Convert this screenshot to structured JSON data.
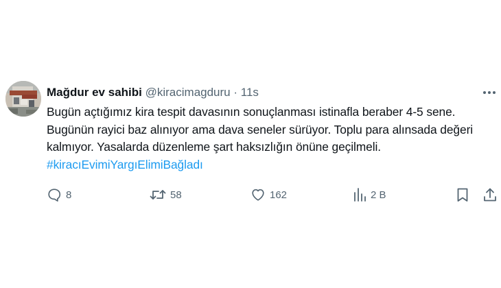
{
  "tweet": {
    "author_name": "Mağdur ev sahibi",
    "handle": "@kiracimagduru",
    "separator": "·",
    "time": "11s",
    "text_main": "Bugün açtığımız kira tespit davasının sonuçlanması istinafla beraber 4-5 sene. Bugünün rayici baz alınıyor ama dava seneler sürüyor. Toplu para alınsada değeri kalmıyor. Yasalarda düzenleme şart haksızlığın önüne geçilmeli.",
    "hashtag": "#kiracıEvimiYargıElimiBağladı",
    "hashtag_color": "#1d9bf0"
  },
  "actions": {
    "reply_count": "8",
    "retweet_count": "58",
    "like_count": "162",
    "views_count": "2 B"
  },
  "icons": {
    "avatar": "profile-photo",
    "more": "more-horizontal-icon",
    "reply": "reply-icon",
    "retweet": "retweet-icon",
    "like": "heart-icon",
    "views": "bar-chart-icon",
    "bookmark": "bookmark-icon",
    "share": "share-icon"
  },
  "colors": {
    "text": "#0f1419",
    "muted": "#536471",
    "link": "#1d9bf0"
  }
}
